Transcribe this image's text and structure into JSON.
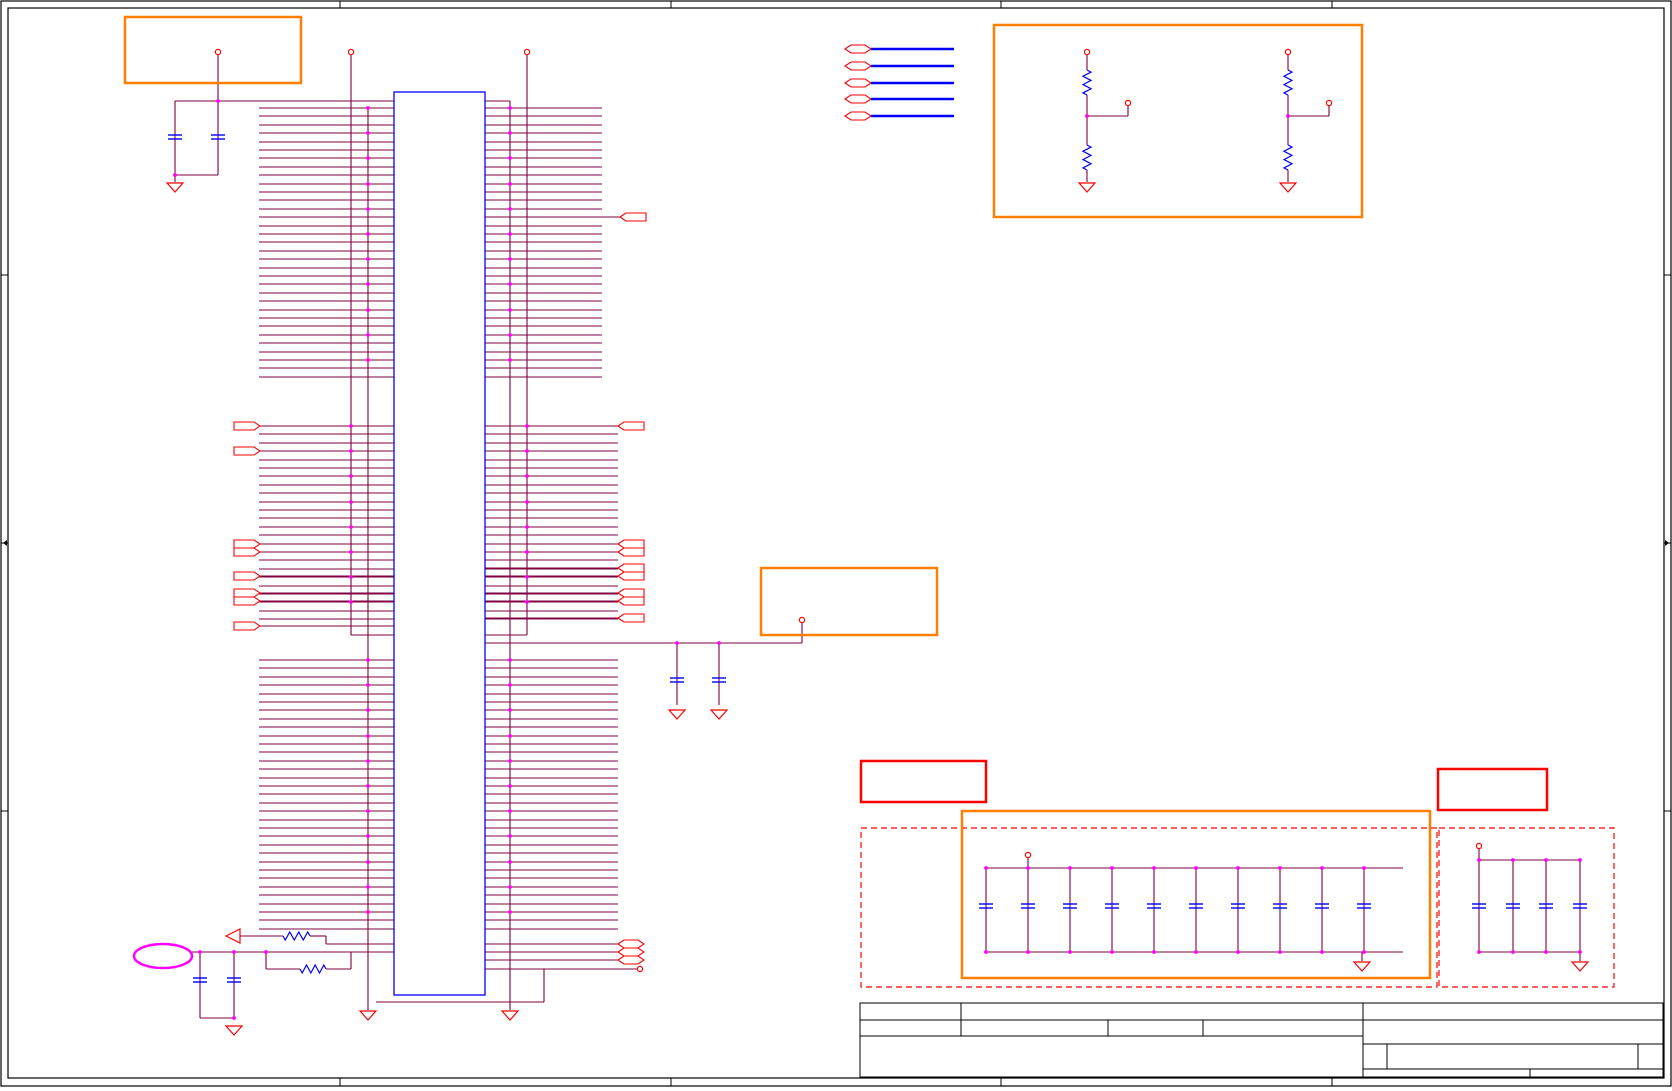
{
  "schematic": {
    "colors": {
      "border": "#000000",
      "wire": "#800040",
      "part": "#0000ff",
      "junction": "#ff00ff",
      "power": "#ff0000",
      "note_box": "#ff8000",
      "alert_box": "#ff0000",
      "bus": "#0000ff"
    },
    "title_block": {
      "title": "",
      "size": "",
      "document_number": "",
      "revision": "",
      "date": "",
      "sheet": ""
    }
  }
}
